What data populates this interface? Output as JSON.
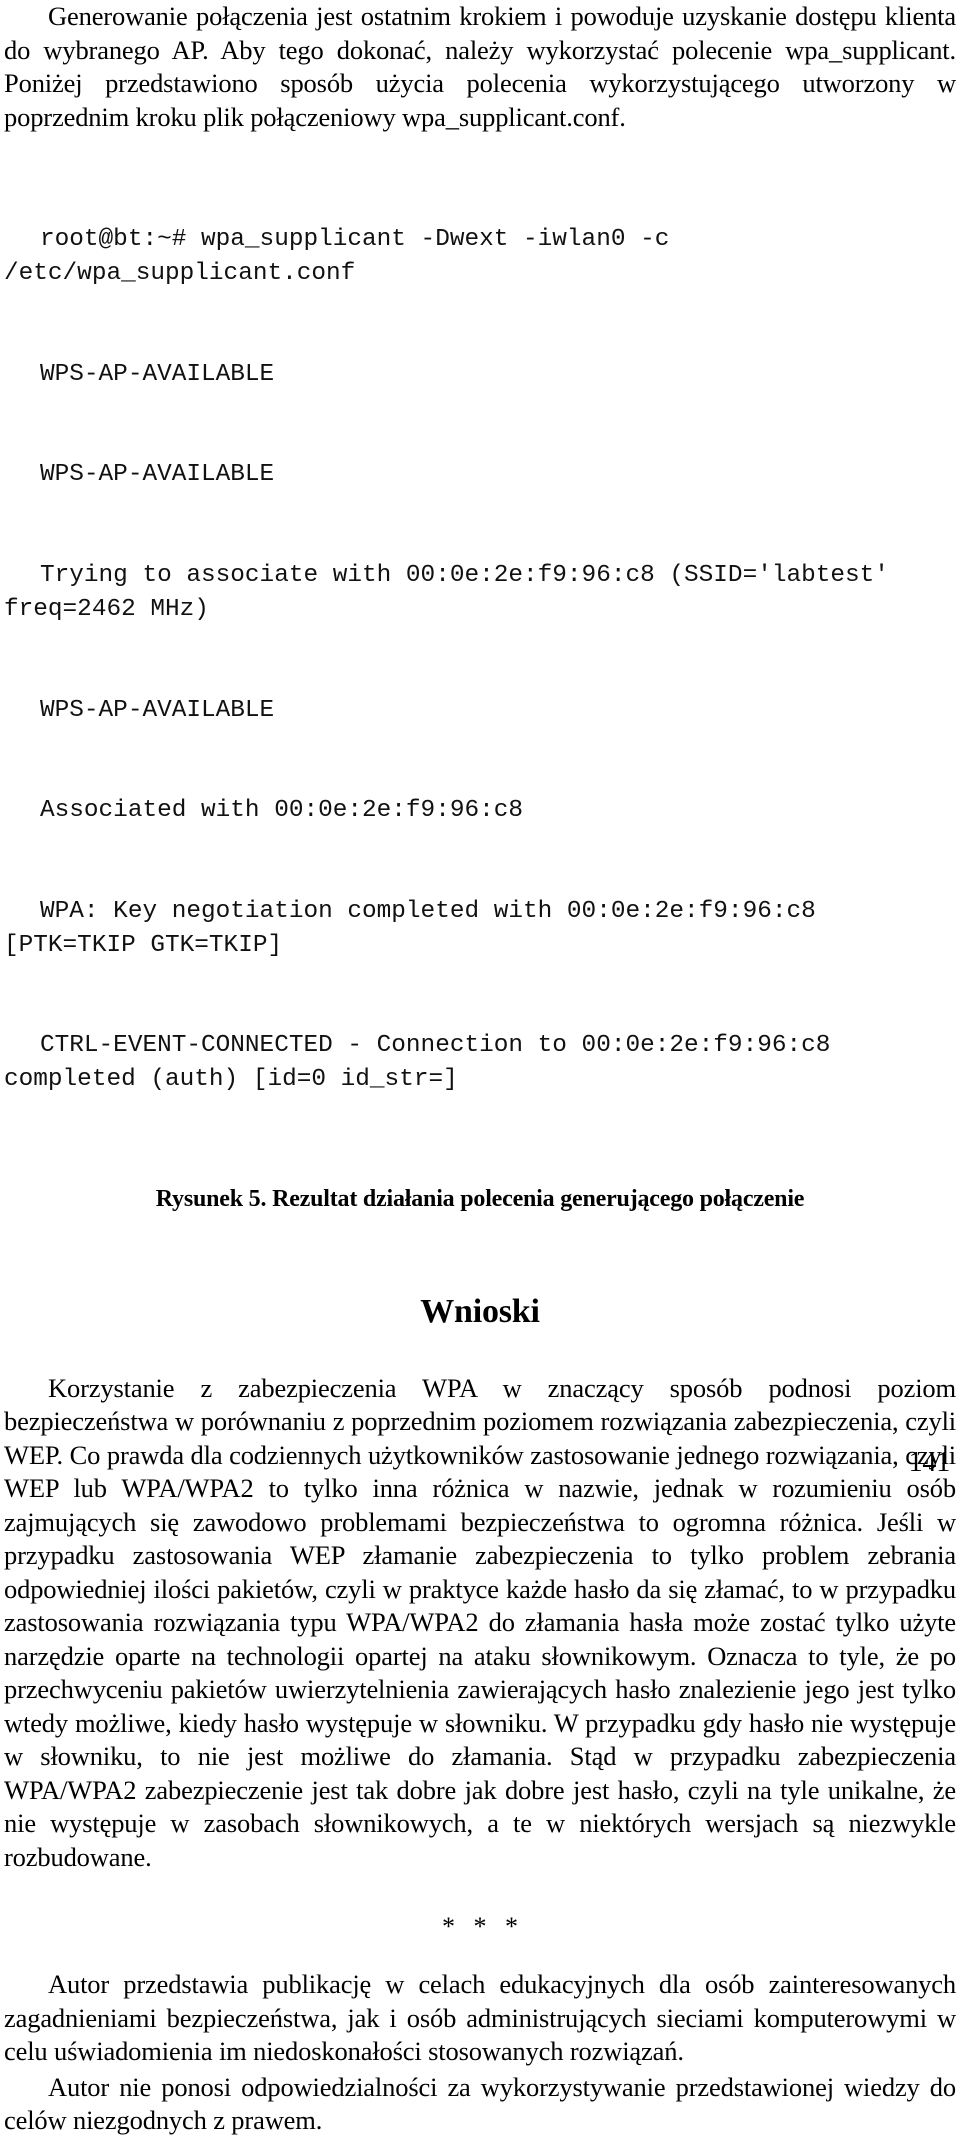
{
  "document": {
    "language": "pl",
    "page_number": "141",
    "text_color": "#000000",
    "background_color": "#ffffff"
  },
  "intro": {
    "paragraph": "Generowanie połączenia jest ostatnim krokiem i powoduje uzyskanie dostępu klienta do wybranego AP. Aby tego dokonać, należy wykorzystać polecenie wpa_supplicant. Poniżej przedstawiono sposób użycia polecenia wykorzystującego utworzony w poprzednim kroku plik połączeniowy wpa_supplicant.conf."
  },
  "terminal": {
    "lines": [
      "root@bt:~# wpa_supplicant -Dwext -iwlan0 -c /etc/wpa_supplicant.conf",
      "WPS-AP-AVAILABLE",
      "WPS-AP-AVAILABLE",
      "Trying to associate with 00:0e:2e:f9:96:c8 (SSID='labtest' freq=2462 MHz)",
      "WPS-AP-AVAILABLE",
      "Associated with 00:0e:2e:f9:96:c8",
      "WPA: Key negotiation completed with 00:0e:2e:f9:96:c8 [PTK=TKIP GTK=TKIP]",
      "CTRL-EVENT-CONNECTED - Connection to 00:0e:2e:f9:96:c8 completed (auth) [id=0 id_str=]"
    ],
    "prompt": "root@bt:~#",
    "command": "wpa_supplicant -Dwext -iwlan0 -c /etc/wpa_supplicant.conf",
    "bssid": "00:0e:2e:f9:96:c8",
    "ssid": "labtest",
    "frequency": "2462 MHz"
  },
  "figure": {
    "caption": "Rysunek 5. Rezultat działania polecenia generującego połączenie",
    "label": "Rysunek 5.",
    "title": "Rezultat działania polecenia generującego połączenie"
  },
  "conclusions": {
    "heading": "Wnioski",
    "paragraph": "Korzystanie z zabezpieczenia WPA w znaczący sposób podnosi poziom bezpieczeństwa w porównaniu z poprzednim poziomem rozwiązania zabezpieczenia, czyli WEP. Co prawda dla codziennych użytkowników zastosowanie jednego rozwiązania, czyli WEP lub WPA/WPA2 to tylko inna różnica w nazwie, jednak w rozumieniu osób zajmujących się zawodowo problemami bezpieczeństwa to ogromna różnica. Jeśli w przypadku zastosowania WEP złamanie zabezpieczenia to tylko problem zebrania odpowiedniej ilości pakietów, czyli w praktyce każde hasło da się złamać, to w przypadku zastosowania rozwiązania typu WPA/WPA2 do złamania hasła może zostać tylko użyte narzędzie oparte na technologii opartej na ataku słownikowym. Oznacza to tyle, że po przechwyceniu pakietów uwierzytelnienia zawierających hasło znalezienie jego jest tylko wtedy możliwe, kiedy hasło występuje w słowniku. W przypadku gdy hasło nie występuje w słowniku, to nie jest możliwe do złamania. Stąd w przypadku zabezpieczenia WPA/WPA2 zabezpieczenie jest tak dobre jak dobre jest hasło, czyli na tyle unikalne, że nie występuje w zasobach słownikowych, a te w niektórych wersjach są niezwykle rozbudowane."
  },
  "separator": {
    "asterisks": "* * *"
  },
  "disclaimer": {
    "paragraph_1": "Autor przedstawia publikację w celach edukacyjnych dla osób zainteresowanych zagadnieniami bezpieczeństwa, jak i osób administrujących sieciami komputerowymi w celu uświadomienia im niedoskonałości stosowanych rozwiązań.",
    "paragraph_2": "Autor nie ponosi odpowiedzialności za wykorzystywanie przedstawionej wiedzy do celów niezgodnych z prawem."
  }
}
